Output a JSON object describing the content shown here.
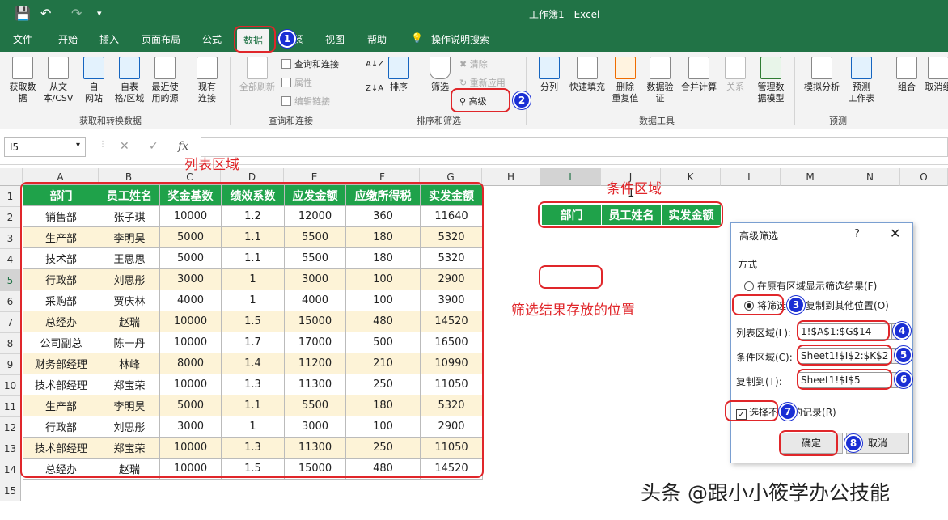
{
  "window": {
    "title": "工作簿1  -  Excel"
  },
  "tabs": [
    {
      "label": "文件",
      "active": false
    },
    {
      "label": "开始",
      "active": false
    },
    {
      "label": "插入",
      "active": false
    },
    {
      "label": "页面布局",
      "active": false
    },
    {
      "label": "公式",
      "active": false
    },
    {
      "label": "数据",
      "active": true
    },
    {
      "label": "阅",
      "active": false
    },
    {
      "label": "视图",
      "active": false
    },
    {
      "label": "帮助",
      "active": false
    },
    {
      "label": "操作说明搜索",
      "active": false
    }
  ],
  "ribbon": {
    "get_data": "获取数\n据",
    "from_text": "从文\n本/CSV",
    "from_web": "自\n网站",
    "from_table": "自表\n格/区域",
    "recent": "最近使\n用的源",
    "existing": "现有\n连接",
    "group_get": "获取和转换数据",
    "refresh_all": "全部刷新",
    "queries": "查询和连接",
    "properties": "属性",
    "edit_links": "编辑链接",
    "group_queries": "查询和连接",
    "sort": "排序",
    "filter": "筛选",
    "clear": "清除",
    "reapply": "重新应用",
    "advanced": "高级",
    "group_sort": "排序和筛选",
    "split": "分列",
    "flash_fill": "快速填充",
    "remove_dup": "删除\n重复值",
    "validate": "数据验\n证",
    "consolidate": "合并计算",
    "relations": "关系",
    "manage_model": "管理数\n据模型",
    "group_tools": "数据工具",
    "what_if": "模拟分析",
    "forecast": "预测\n工作表",
    "group_forecast": "预测",
    "group_btn": "组合",
    "ungroup": "取消组"
  },
  "formula_bar": {
    "name_box": "I5",
    "fx": "fx"
  },
  "columns": [
    "A",
    "B",
    "C",
    "D",
    "E",
    "F",
    "G",
    "H",
    "I",
    "J",
    "K",
    "L",
    "M",
    "N",
    "O"
  ],
  "rows": [
    "1",
    "2",
    "3",
    "4",
    "5",
    "6",
    "7",
    "8",
    "9",
    "10",
    "11",
    "12",
    "13",
    "14",
    "15"
  ],
  "table": {
    "headers": [
      "部门",
      "员工姓名",
      "奖金基数",
      "绩效系数",
      "应发金额",
      "应缴所得税",
      "实发金额"
    ],
    "rows": [
      [
        "销售部",
        "张子琪",
        "10000",
        "1.2",
        "12000",
        "360",
        "11640"
      ],
      [
        "生产部",
        "李明昊",
        "5000",
        "1.1",
        "5500",
        "180",
        "5320"
      ],
      [
        "技术部",
        "王思思",
        "5000",
        "1.1",
        "5500",
        "180",
        "5320"
      ],
      [
        "行政部",
        "刘思彤",
        "3000",
        "1",
        "3000",
        "100",
        "2900"
      ],
      [
        "采购部",
        "贾庆林",
        "4000",
        "1",
        "4000",
        "100",
        "3900"
      ],
      [
        "总经办",
        "赵瑞",
        "10000",
        "1.5",
        "15000",
        "480",
        "14520"
      ],
      [
        "公司副总",
        "陈一丹",
        "10000",
        "1.7",
        "17000",
        "500",
        "16500"
      ],
      [
        "财务部经理",
        "林峰",
        "8000",
        "1.4",
        "11200",
        "210",
        "10990"
      ],
      [
        "技术部经理",
        "郑宝荣",
        "10000",
        "1.3",
        "11300",
        "250",
        "11050"
      ],
      [
        "生产部",
        "李明昊",
        "5000",
        "1.1",
        "5500",
        "180",
        "5320"
      ],
      [
        "行政部",
        "刘思彤",
        "3000",
        "1",
        "3000",
        "100",
        "2900"
      ],
      [
        "技术部经理",
        "郑宝荣",
        "10000",
        "1.3",
        "11300",
        "250",
        "11050"
      ],
      [
        "总经办",
        "赵瑞",
        "10000",
        "1.5",
        "15000",
        "480",
        "14520"
      ]
    ]
  },
  "criteria": {
    "headers": [
      "部门",
      "员工姓名",
      "实发金额"
    ],
    "col_j_value": "1"
  },
  "annotations": {
    "list_area": "列表区域",
    "criteria_area": "条件区域",
    "result_pos": "筛选结果存放的位置",
    "badges": [
      "1",
      "2",
      "3",
      "4",
      "5",
      "6",
      "7",
      "8"
    ]
  },
  "dialog": {
    "title": "高级筛选",
    "help": "?",
    "close": "✕",
    "method": "方式",
    "option1": "在原有区域显示筛选结果(F)",
    "option2_a": "将筛选",
    "option2_b": "复制到其他位置(O)",
    "list_label": "列表区域(L):",
    "list_value": "1!$A$1:$G$14",
    "criteria_label": "条件区域(C):",
    "criteria_value": "Sheet1!$I$2:$K$2",
    "copy_label": "复制到(T):",
    "copy_value": "Sheet1!$I$5",
    "unique_a": "选择不",
    "unique_b": "的记录(R)",
    "ok": "确定",
    "cancel": "取消"
  },
  "watermark": "头条 @跟小小筱学办公技能"
}
